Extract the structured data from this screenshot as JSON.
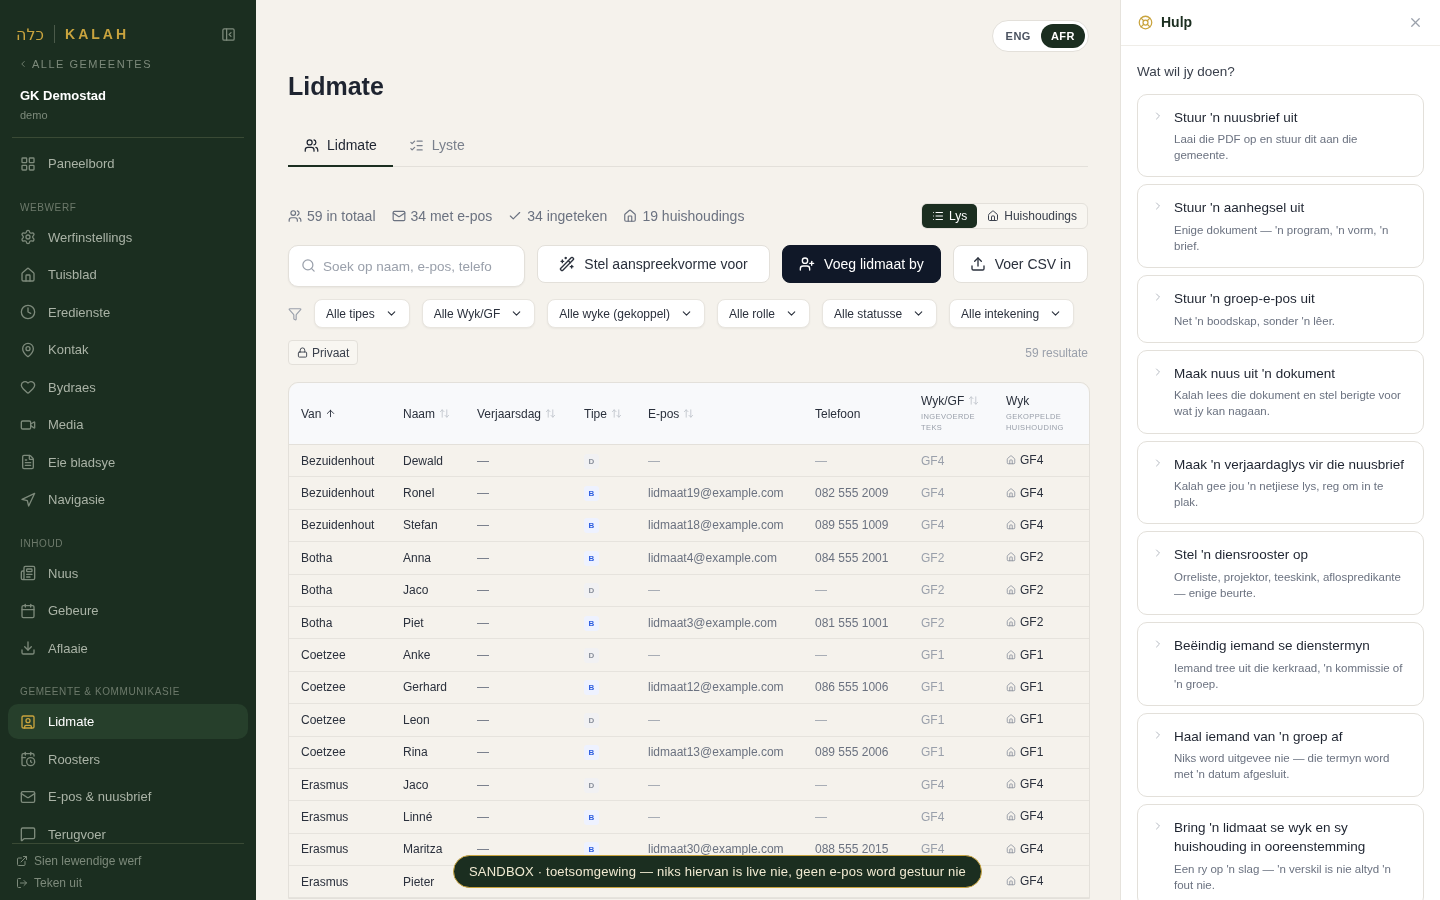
{
  "sidebar": {
    "logo": {
      "mark": "כלה",
      "name": "KALAH"
    },
    "back_link": "ALLE GEMEENTES",
    "org": {
      "name": "GK Demostad",
      "slug": "demo"
    },
    "sections": [
      {
        "items": [
          {
            "label": "Paneelbord",
            "selected": false
          }
        ]
      },
      {
        "label": "WEBWERF",
        "items": [
          {
            "label": "Werfinstellings",
            "selected": false
          },
          {
            "label": "Tuisblad",
            "selected": false
          },
          {
            "label": "Eredienste",
            "selected": false
          },
          {
            "label": "Kontak",
            "selected": false
          },
          {
            "label": "Bydraes",
            "selected": false
          },
          {
            "label": "Media",
            "selected": false
          },
          {
            "label": "Eie bladsye",
            "selected": false
          },
          {
            "label": "Navigasie",
            "selected": false
          }
        ]
      },
      {
        "label": "INHOUD",
        "items": [
          {
            "label": "Nuus",
            "selected": false
          },
          {
            "label": "Gebeure",
            "selected": false
          },
          {
            "label": "Aflaaie",
            "selected": false
          }
        ]
      },
      {
        "label": "GEMEENTE & KOMMUNIKASIE",
        "items": [
          {
            "label": "Lidmate",
            "selected": true
          },
          {
            "label": "Roosters",
            "selected": false
          },
          {
            "label": "E-pos & nuusbrief",
            "selected": false
          },
          {
            "label": "Terugvoer",
            "selected": false
          }
        ]
      }
    ],
    "footer_links": [
      "Sien lewendige werf",
      "Teken uit"
    ]
  },
  "language": [
    {
      "label": "ENG",
      "selected": false
    },
    {
      "label": "AFR",
      "selected": true
    }
  ],
  "page_title": "Lidmate",
  "tabs": [
    {
      "label": "Lidmate",
      "selected": true
    },
    {
      "label": "Lyste",
      "selected": false
    }
  ],
  "stats": [
    "59 in totaal",
    "34 met e-pos",
    "34 ingeteken",
    "19 huishoudings"
  ],
  "view_toggle": [
    {
      "label": "Lys",
      "selected": true
    },
    {
      "label": "Huishoudings",
      "selected": false
    }
  ],
  "search": {
    "placeholder": "Soek op naam, e-pos, telefo"
  },
  "actions": [
    {
      "label": "Stel aanspreekvorme voor",
      "primary": false
    },
    {
      "label": "Voeg lidmaat by",
      "primary": true
    },
    {
      "label": "Voer CSV in",
      "primary": false
    }
  ],
  "filters": [
    "Alle tipes",
    "Alle Wyk/GF",
    "Alle wyke (gekoppel)",
    "Alle rolle",
    "Alle statusse",
    "Alle intekening"
  ],
  "privacy_chip": "Privaat",
  "result_count": "59 resultate",
  "table": {
    "columns": [
      {
        "label": "Van",
        "sortable": true,
        "sorted": true
      },
      {
        "label": "Naam",
        "sortable": true,
        "sorted": false
      },
      {
        "label": "Verjaarsdag",
        "sortable": true,
        "sorted": false
      },
      {
        "label": "Tipe",
        "sortable": true,
        "sorted": false
      },
      {
        "label": "E-pos",
        "sortable": true,
        "sorted": false
      },
      {
        "label": "Telefoon",
        "sortable": false,
        "sorted": false
      },
      {
        "label": "Wyk/GF",
        "sortable": true,
        "sorted": false,
        "sub": "INGEVOERDE TEKS"
      },
      {
        "label": "Wyk",
        "sortable": false,
        "sorted": false,
        "sub": "GEKOPPELDE HUISHOUDING"
      }
    ],
    "rows": [
      {
        "van": "Bezuidenhout",
        "naam": "Dewald",
        "verjaarsdag": "—",
        "tipe": "D",
        "kind": "d",
        "epos": "—",
        "telefoon": "—",
        "wyk_gf": "GF4",
        "wyk": "GF4"
      },
      {
        "van": "Bezuidenhout",
        "naam": "Ronel",
        "verjaarsdag": "—",
        "tipe": "B",
        "kind": "b",
        "epos": "lidmaat19@example.com",
        "telefoon": "082 555 2009",
        "wyk_gf": "GF4",
        "wyk": "GF4"
      },
      {
        "van": "Bezuidenhout",
        "naam": "Stefan",
        "verjaarsdag": "—",
        "tipe": "B",
        "kind": "b",
        "epos": "lidmaat18@example.com",
        "telefoon": "089 555 1009",
        "wyk_gf": "GF4",
        "wyk": "GF4"
      },
      {
        "van": "Botha",
        "naam": "Anna",
        "verjaarsdag": "—",
        "tipe": "B",
        "kind": "b",
        "epos": "lidmaat4@example.com",
        "telefoon": "084 555 2001",
        "wyk_gf": "GF2",
        "wyk": "GF2"
      },
      {
        "van": "Botha",
        "naam": "Jaco",
        "verjaarsdag": "—",
        "tipe": "D",
        "kind": "d",
        "epos": "—",
        "telefoon": "—",
        "wyk_gf": "GF2",
        "wyk": "GF2"
      },
      {
        "van": "Botha",
        "naam": "Piet",
        "verjaarsdag": "—",
        "tipe": "B",
        "kind": "b",
        "epos": "lidmaat3@example.com",
        "telefoon": "081 555 1001",
        "wyk_gf": "GF2",
        "wyk": "GF2"
      },
      {
        "van": "Coetzee",
        "naam": "Anke",
        "verjaarsdag": "—",
        "tipe": "D",
        "kind": "d",
        "epos": "—",
        "telefoon": "—",
        "wyk_gf": "GF1",
        "wyk": "GF1"
      },
      {
        "van": "Coetzee",
        "naam": "Gerhard",
        "verjaarsdag": "—",
        "tipe": "B",
        "kind": "b",
        "epos": "lidmaat12@example.com",
        "telefoon": "086 555 1006",
        "wyk_gf": "GF1",
        "wyk": "GF1"
      },
      {
        "van": "Coetzee",
        "naam": "Leon",
        "verjaarsdag": "—",
        "tipe": "D",
        "kind": "d",
        "epos": "—",
        "telefoon": "—",
        "wyk_gf": "GF1",
        "wyk": "GF1"
      },
      {
        "van": "Coetzee",
        "naam": "Rina",
        "verjaarsdag": "—",
        "tipe": "B",
        "kind": "b",
        "epos": "lidmaat13@example.com",
        "telefoon": "089 555 2006",
        "wyk_gf": "GF1",
        "wyk": "GF1"
      },
      {
        "van": "Erasmus",
        "naam": "Jaco",
        "verjaarsdag": "—",
        "tipe": "D",
        "kind": "d",
        "epos": "—",
        "telefoon": "—",
        "wyk_gf": "GF4",
        "wyk": "GF4"
      },
      {
        "van": "Erasmus",
        "naam": "Linné",
        "verjaarsdag": "—",
        "tipe": "B",
        "kind": "b",
        "epos": "—",
        "telefoon": "—",
        "wyk_gf": "GF4",
        "wyk": "GF4"
      },
      {
        "van": "Erasmus",
        "naam": "Maritza",
        "verjaarsdag": "—",
        "tipe": "B",
        "kind": "b",
        "epos": "lidmaat30@example.com",
        "telefoon": "088 555 2015",
        "wyk_gf": "GF4",
        "wyk": "GF4"
      },
      {
        "van": "Erasmus",
        "naam": "Pieter",
        "wyk": "GF4"
      }
    ]
  },
  "sandbox_banner": "SANDBOX · toetsomgewing — niks hiervan is live nie, geen e-pos word gestuur nie",
  "help": {
    "title": "Hulp",
    "prompt": "Wat wil jy doen?",
    "items": [
      {
        "title": "Stuur 'n nuusbrief uit",
        "description": "Laai die PDF op en stuur dit aan die gemeente."
      },
      {
        "title": "Stuur 'n aanhegsel uit",
        "description": "Enige dokument — 'n program, 'n vorm, 'n brief."
      },
      {
        "title": "Stuur 'n groep-e-pos uit",
        "description": "Net 'n boodskap, sonder 'n lêer."
      },
      {
        "title": "Maak nuus uit 'n dokument",
        "description": "Kalah lees die dokument en stel berigte voor wat jy kan nagaan."
      },
      {
        "title": "Maak 'n verjaardaglys vir die nuusbrief",
        "description": "Kalah gee jou 'n netjiese lys, reg om in te plak."
      },
      {
        "title": "Stel 'n diensrooster op",
        "description": "Orreliste, projektor, teeskink, aflospredikante — enige beurte."
      },
      {
        "title": "Beëindig iemand se dienstermyn",
        "description": "Iemand tree uit die kerkraad, 'n kommissie of 'n groep."
      },
      {
        "title": "Haal iemand van 'n groep af",
        "description": "Niks word uitgevee nie — die termyn word met 'n datum afgesluit."
      },
      {
        "title": "Bring 'n lidmaat se wyk en sy huishouding in ooreenstemming",
        "description": "Een ry op 'n slag — 'n verskil is nie altyd 'n fout nie."
      }
    ]
  }
}
